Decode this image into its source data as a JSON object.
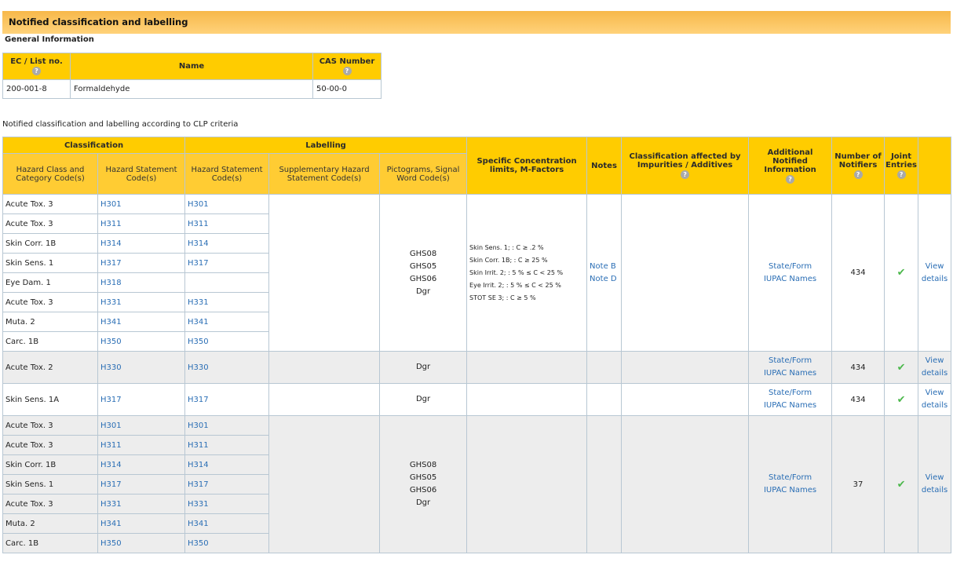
{
  "banner_title": "Notified classification and labelling",
  "general_info_label": "General Information",
  "info_table": {
    "headers": [
      "EC / List no.",
      "Name",
      "CAS Number"
    ],
    "row": {
      "ec": "200-001-8",
      "name": "Formaldehyde",
      "cas": "50-00-0"
    }
  },
  "intro_text": "Notified classification and labelling according to CLP criteria",
  "headers": {
    "classification": "Classification",
    "labelling": "Labelling",
    "hazard_class": "Hazard Class and Category Code(s)",
    "hazard_statement": "Hazard Statement Code(s)",
    "label_hazard_statement": "Hazard Statement Code(s)",
    "supplementary": "Supplementary Hazard Statement Code(s)",
    "pictograms": "Pictograms, Signal Word Code(s)",
    "scl": "Specific Concentration limits, M-Factors",
    "notes": "Notes",
    "impurities": "Classification affected by Impurities / Additives",
    "additional": "Additional Notified Information",
    "number_of_notifiers": "Number of Notifiers",
    "joint_entries": "Joint Entries"
  },
  "groups": [
    {
      "rows": [
        {
          "hazard_class": "Acute Tox. 3",
          "hazard_statement": "H301",
          "label_statement": "H301"
        },
        {
          "hazard_class": "Acute Tox. 3",
          "hazard_statement": "H311",
          "label_statement": "H311"
        },
        {
          "hazard_class": "Skin Corr. 1B",
          "hazard_statement": "H314",
          "label_statement": "H314"
        },
        {
          "hazard_class": "Skin Sens. 1",
          "hazard_statement": "H317",
          "label_statement": "H317"
        },
        {
          "hazard_class": "Eye Dam. 1",
          "hazard_statement": "H318",
          "label_statement": ""
        },
        {
          "hazard_class": "Acute Tox. 3",
          "hazard_statement": "H331",
          "label_statement": "H331"
        },
        {
          "hazard_class": "Muta. 2",
          "hazard_statement": "H341",
          "label_statement": "H341"
        },
        {
          "hazard_class": "Carc. 1B",
          "hazard_statement": "H350",
          "label_statement": "H350"
        }
      ],
      "pictograms": [
        "GHS08",
        "GHS05",
        "GHS06",
        "Dgr"
      ],
      "scl": [
        "Skin Sens. 1; : C ≥ .2 %",
        "Skin Corr. 1B; : C ≥ 25 %",
        "Skin Irrit. 2; : 5 % ≤ C < 25 %",
        "Eye Irrit. 2; : 5 % ≤ C < 25 %",
        "STOT SE 3; : C ≥ 5 %"
      ],
      "notes": [
        "Note B",
        "Note D"
      ],
      "additional": [
        "State/Form",
        "IUPAC Names"
      ],
      "notifiers": "434",
      "view": [
        "View",
        "details"
      ]
    },
    {
      "rows": [
        {
          "hazard_class": "Acute Tox. 2",
          "hazard_statement": "H330",
          "label_statement": "H330"
        }
      ],
      "pictograms": [
        "Dgr"
      ],
      "scl": [],
      "notes": [],
      "additional": [
        "State/Form",
        "IUPAC Names"
      ],
      "notifiers": "434",
      "view": [
        "View",
        "details"
      ]
    },
    {
      "rows": [
        {
          "hazard_class": "Skin Sens. 1A",
          "hazard_statement": "H317",
          "label_statement": "H317"
        }
      ],
      "pictograms": [
        "Dgr"
      ],
      "scl": [],
      "notes": [],
      "additional": [
        "State/Form",
        "IUPAC Names"
      ],
      "notifiers": "434",
      "view": [
        "View",
        "details"
      ]
    },
    {
      "rows": [
        {
          "hazard_class": "Acute Tox. 3",
          "hazard_statement": "H301",
          "label_statement": "H301"
        },
        {
          "hazard_class": "Acute Tox. 3",
          "hazard_statement": "H311",
          "label_statement": "H311"
        },
        {
          "hazard_class": "Skin Corr. 1B",
          "hazard_statement": "H314",
          "label_statement": "H314"
        },
        {
          "hazard_class": "Skin Sens. 1",
          "hazard_statement": "H317",
          "label_statement": "H317"
        },
        {
          "hazard_class": "Acute Tox. 3",
          "hazard_statement": "H331",
          "label_statement": "H331"
        },
        {
          "hazard_class": "Muta. 2",
          "hazard_statement": "H341",
          "label_statement": "H341"
        },
        {
          "hazard_class": "Carc. 1B",
          "hazard_statement": "H350",
          "label_statement": "H350"
        }
      ],
      "pictograms": [
        "GHS08",
        "GHS05",
        "GHS06",
        "Dgr"
      ],
      "scl": [],
      "notes": [],
      "additional": [
        "State/Form",
        "IUPAC Names"
      ],
      "notifiers": "37",
      "view": [
        "View",
        "details"
      ]
    }
  ],
  "icons": {
    "help": "question-icon",
    "joint": "checkmark-icon"
  },
  "help_glyph": "?",
  "check_glyph": "✔",
  "colors": {
    "header": "#ffcc00",
    "banner": "#ffc04a",
    "link": "#2a6eb5",
    "check": "#4cb84c",
    "alt_row": "#ededed"
  }
}
